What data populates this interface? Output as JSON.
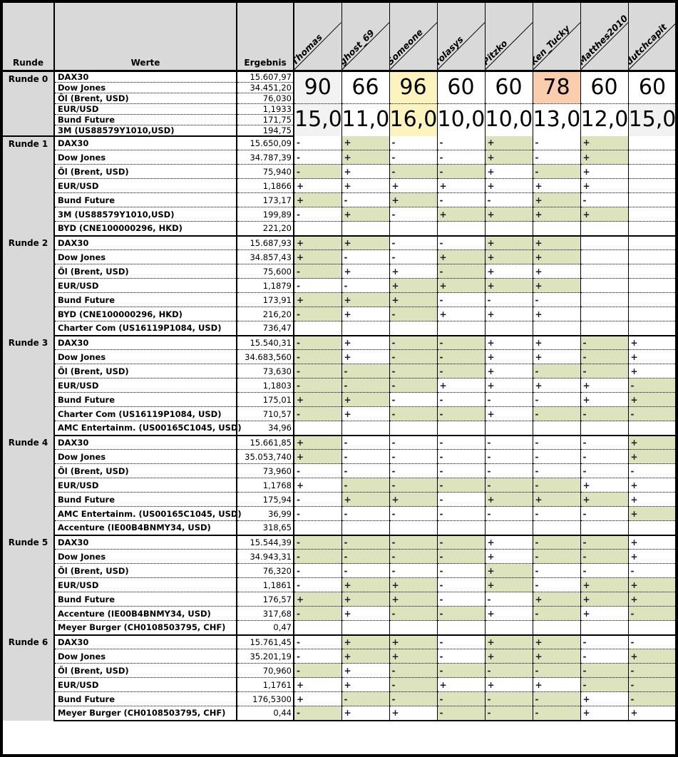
{
  "columns": {
    "runde_label": "Runde",
    "werte_label": "Werte",
    "ergebnis_label": "Ergebnis",
    "players": [
      "Thomas",
      "ghost_69",
      "Someone",
      "rolasys",
      "Pitzko",
      "Ken_Tucky",
      "Matthes2010",
      "dutchcapit"
    ]
  },
  "colors": {
    "header_gray": "#d9d9d9",
    "highlight_green": "#dde3bd",
    "leader_yellow": "#fdf3bf",
    "peach": "#f9cdae",
    "light_gray": "#f2f2f2"
  },
  "rounds": [
    {
      "label": "Runde 0",
      "scores": [
        "90",
        "66",
        "96",
        "60",
        "60",
        "78",
        "60",
        "60"
      ],
      "score_bg": [
        "gray",
        "white",
        "yellow",
        "white",
        "white",
        "peach",
        "white",
        "white"
      ],
      "averages": [
        "15,0",
        "11,0",
        "16,0",
        "10,0",
        "10,0",
        "13,0",
        "12,0",
        "15,0"
      ],
      "avg_bg": [
        "gray",
        "white",
        "yellow",
        "white",
        "white",
        "white",
        "white",
        "gray"
      ],
      "rows": [
        {
          "name": "DAX30",
          "value": "15.607,97"
        },
        {
          "name": "Dow Jones",
          "value": "34.451,20"
        },
        {
          "name": "Öl (Brent, USD)",
          "value": "76,030"
        },
        {
          "name": "EUR/USD",
          "value": "1,1933"
        },
        {
          "name": "Bund Future",
          "value": "171,75"
        },
        {
          "name": "3M (US88579Y1010,USD)",
          "value": "194,75"
        }
      ]
    },
    {
      "label": "Runde 1",
      "rows": [
        {
          "name": "DAX30",
          "value": "15.650,09",
          "picks": [
            "-",
            "+",
            "-",
            "-",
            "+",
            "-",
            "+",
            ""
          ],
          "hl": [
            0,
            1,
            0,
            0,
            1,
            0,
            1,
            0
          ]
        },
        {
          "name": "Dow Jones",
          "value": "34.787,39",
          "picks": [
            "-",
            "+",
            "-",
            "-",
            "+",
            "-",
            "+",
            ""
          ],
          "hl": [
            0,
            1,
            0,
            0,
            1,
            0,
            1,
            0
          ]
        },
        {
          "name": "Öl (Brent, USD)",
          "value": "75,940",
          "picks": [
            "-",
            "+",
            "-",
            "-",
            "+",
            "-",
            "+",
            ""
          ],
          "hl": [
            1,
            0,
            1,
            1,
            0,
            1,
            0,
            0
          ]
        },
        {
          "name": "EUR/USD",
          "value": "1,1866",
          "picks": [
            "+",
            "+",
            "+",
            "+",
            "+",
            "+",
            "+",
            ""
          ],
          "hl": [
            0,
            0,
            0,
            0,
            0,
            0,
            0,
            0
          ]
        },
        {
          "name": "Bund Future",
          "value": "173,17",
          "picks": [
            "+",
            "-",
            "+",
            "-",
            "-",
            "+",
            "-",
            ""
          ],
          "hl": [
            1,
            0,
            1,
            0,
            0,
            1,
            0,
            0
          ]
        },
        {
          "name": "3M (US88579Y1010,USD)",
          "value": "199,89",
          "picks": [
            "-",
            "+",
            "-",
            "+",
            "+",
            "+",
            "+",
            ""
          ],
          "hl": [
            0,
            1,
            0,
            1,
            1,
            1,
            1,
            0
          ]
        },
        {
          "name": "BYD (CNE100000296, HKD)",
          "value": "221,20",
          "picks": [
            "",
            "",
            "",
            "",
            "",
            "",
            "",
            ""
          ],
          "hl": [
            0,
            0,
            0,
            0,
            0,
            0,
            0,
            0
          ]
        }
      ]
    },
    {
      "label": "Runde 2",
      "rows": [
        {
          "name": "DAX30",
          "value": "15.687,93",
          "picks": [
            "+",
            "+",
            "-",
            "-",
            "+",
            "+",
            "",
            ""
          ],
          "hl": [
            1,
            1,
            0,
            0,
            1,
            1,
            0,
            0
          ]
        },
        {
          "name": "Dow Jones",
          "value": "34.857,43",
          "picks": [
            "+",
            "-",
            "-",
            "+",
            "+",
            "+",
            "",
            ""
          ],
          "hl": [
            1,
            0,
            0,
            1,
            1,
            1,
            0,
            0
          ]
        },
        {
          "name": "Öl (Brent, USD)",
          "value": "75,600",
          "picks": [
            "-",
            "+",
            "+",
            "-",
            "+",
            "+",
            "",
            ""
          ],
          "hl": [
            1,
            0,
            0,
            1,
            0,
            0,
            0,
            0
          ]
        },
        {
          "name": "EUR/USD",
          "value": "1,1879",
          "picks": [
            "-",
            "-",
            "+",
            "+",
            "+",
            "+",
            "",
            ""
          ],
          "hl": [
            0,
            0,
            1,
            1,
            1,
            1,
            0,
            0
          ]
        },
        {
          "name": "Bund Future",
          "value": "173,91",
          "picks": [
            "+",
            "+",
            "+",
            "-",
            "-",
            "-",
            "",
            ""
          ],
          "hl": [
            1,
            1,
            1,
            0,
            0,
            0,
            0,
            0
          ]
        },
        {
          "name": "BYD (CNE100000296, HKD)",
          "value": "216,20",
          "picks": [
            "-",
            "+",
            "-",
            "+",
            "+",
            "+",
            "",
            ""
          ],
          "hl": [
            1,
            0,
            1,
            0,
            0,
            0,
            0,
            0
          ]
        },
        {
          "name": "Charter Com (US16119P1084, USD)",
          "value": "736,47",
          "picks": [
            "",
            "",
            "",
            "",
            "",
            "",
            "",
            ""
          ],
          "hl": [
            0,
            0,
            0,
            0,
            0,
            0,
            0,
            0
          ]
        }
      ]
    },
    {
      "label": "Runde 3",
      "rows": [
        {
          "name": "DAX30",
          "value": "15.540,31",
          "picks": [
            "-",
            "+",
            "-",
            "-",
            "+",
            "+",
            "-",
            "+"
          ],
          "hl": [
            1,
            0,
            1,
            1,
            0,
            0,
            1,
            0
          ]
        },
        {
          "name": "Dow Jones",
          "value": "34.683,560",
          "picks": [
            "-",
            "+",
            "-",
            "-",
            "+",
            "+",
            "-",
            "+"
          ],
          "hl": [
            1,
            0,
            1,
            1,
            0,
            0,
            1,
            0
          ]
        },
        {
          "name": "Öl (Brent, USD)",
          "value": "73,630",
          "picks": [
            "-",
            "-",
            "-",
            "-",
            "+",
            "-",
            "-",
            "+"
          ],
          "hl": [
            1,
            1,
            1,
            1,
            0,
            1,
            1,
            0
          ]
        },
        {
          "name": "EUR/USD",
          "value": "1,1803",
          "picks": [
            "-",
            "-",
            "-",
            "+",
            "+",
            "+",
            "+",
            "-"
          ],
          "hl": [
            1,
            1,
            1,
            0,
            0,
            0,
            0,
            1
          ]
        },
        {
          "name": "Bund Future",
          "value": "175,01",
          "picks": [
            "+",
            "+",
            "-",
            "-",
            "-",
            "-",
            "+",
            "+"
          ],
          "hl": [
            1,
            1,
            0,
            0,
            0,
            0,
            0,
            1
          ]
        },
        {
          "name": "Charter Com (US16119P1084, USD)",
          "value": "710,57",
          "picks": [
            "-",
            "+",
            "-",
            "-",
            "+",
            "-",
            "-",
            "-"
          ],
          "hl": [
            1,
            0,
            1,
            1,
            0,
            1,
            1,
            1
          ]
        },
        {
          "name": "AMC Entertainm. (US00165C1045, USD)",
          "value": "34,96",
          "picks": [
            "",
            "",
            "",
            "",
            "",
            "",
            "",
            ""
          ],
          "hl": [
            0,
            0,
            0,
            0,
            0,
            0,
            0,
            0
          ]
        }
      ]
    },
    {
      "label": "Runde 4",
      "rows": [
        {
          "name": "DAX30",
          "value": "15.661,85",
          "picks": [
            "+",
            "-",
            "-",
            "-",
            "-",
            "-",
            "-",
            "+"
          ],
          "hl": [
            1,
            0,
            0,
            0,
            0,
            0,
            0,
            1
          ]
        },
        {
          "name": "Dow Jones",
          "value": "35.053,740",
          "picks": [
            "+",
            "-",
            "-",
            "-",
            "-",
            "-",
            "-",
            "+"
          ],
          "hl": [
            1,
            0,
            0,
            0,
            0,
            0,
            0,
            1
          ]
        },
        {
          "name": "Öl (Brent, USD)",
          "value": "73,960",
          "picks": [
            "-",
            "-",
            "-",
            "-",
            "-",
            "-",
            "-",
            "-"
          ],
          "hl": [
            0,
            0,
            0,
            0,
            0,
            0,
            0,
            0
          ]
        },
        {
          "name": "EUR/USD",
          "value": "1,1768",
          "picks": [
            "+",
            "-",
            "-",
            "-",
            "-",
            "-",
            "+",
            "+"
          ],
          "hl": [
            0,
            1,
            1,
            1,
            1,
            1,
            0,
            0
          ]
        },
        {
          "name": "Bund Future",
          "value": "175,94",
          "picks": [
            "-",
            "+",
            "+",
            "-",
            "+",
            "+",
            "+",
            "+"
          ],
          "hl": [
            0,
            1,
            1,
            0,
            1,
            1,
            1,
            0
          ]
        },
        {
          "name": "AMC Entertainm. (US00165C1045, USD)",
          "value": "36,99",
          "picks": [
            "-",
            "-",
            "-",
            "-",
            "-",
            "-",
            "-",
            "+"
          ],
          "hl": [
            0,
            0,
            0,
            0,
            0,
            0,
            0,
            1
          ]
        },
        {
          "name": "Accenture (IE00B4BNMY34, USD)",
          "value": "318,65",
          "picks": [
            "",
            "",
            "",
            "",
            "",
            "",
            "",
            ""
          ],
          "hl": [
            0,
            0,
            0,
            0,
            0,
            0,
            0,
            0
          ]
        }
      ]
    },
    {
      "label": "Runde 5",
      "rows": [
        {
          "name": "DAX30",
          "value": "15.544,39",
          "picks": [
            "-",
            "-",
            "-",
            "-",
            "+",
            "-",
            "-",
            "+"
          ],
          "hl": [
            1,
            1,
            1,
            1,
            0,
            1,
            1,
            0
          ]
        },
        {
          "name": "Dow Jones",
          "value": "34.943,31",
          "picks": [
            "-",
            "-",
            "-",
            "-",
            "+",
            "-",
            "-",
            "+"
          ],
          "hl": [
            1,
            1,
            1,
            1,
            0,
            1,
            1,
            0
          ]
        },
        {
          "name": "Öl (Brent, USD)",
          "value": "76,320",
          "picks": [
            "-",
            "-",
            "-",
            "-",
            "+",
            "-",
            "-",
            "-"
          ],
          "hl": [
            0,
            0,
            0,
            0,
            1,
            0,
            0,
            0
          ]
        },
        {
          "name": "EUR/USD",
          "value": "1,1861",
          "picks": [
            "-",
            "+",
            "+",
            "-",
            "+",
            "-",
            "+",
            "+"
          ],
          "hl": [
            0,
            1,
            1,
            0,
            1,
            0,
            1,
            1
          ]
        },
        {
          "name": "Bund Future",
          "value": "176,57",
          "picks": [
            "+",
            "+",
            "+",
            "-",
            "-",
            "+",
            "+",
            "+"
          ],
          "hl": [
            1,
            1,
            1,
            0,
            0,
            1,
            1,
            1
          ]
        },
        {
          "name": "Accenture (IE00B4BNMY34, USD)",
          "value": "317,68",
          "picks": [
            "-",
            "+",
            "-",
            "-",
            "+",
            "-",
            "+",
            "-"
          ],
          "hl": [
            1,
            0,
            1,
            1,
            0,
            1,
            0,
            1
          ]
        },
        {
          "name": "Meyer Burger (CH0108503795, CHF)",
          "value": "0,47",
          "picks": [
            "",
            "",
            "",
            "",
            "",
            "",
            "",
            ""
          ],
          "hl": [
            0,
            0,
            0,
            0,
            0,
            0,
            0,
            0
          ]
        }
      ]
    },
    {
      "label": "Runde 6",
      "rows": [
        {
          "name": "DAX30",
          "value": "15.761,45",
          "picks": [
            "-",
            "+",
            "+",
            "-",
            "+",
            "+",
            "-",
            "-"
          ],
          "hl": [
            0,
            1,
            1,
            0,
            1,
            1,
            0,
            0
          ]
        },
        {
          "name": "Dow Jones",
          "value": "35.201,19",
          "picks": [
            "-",
            "+",
            "+",
            "-",
            "+",
            "+",
            "-",
            "+"
          ],
          "hl": [
            0,
            1,
            1,
            0,
            1,
            1,
            0,
            1
          ]
        },
        {
          "name": "Öl (Brent, USD)",
          "value": "70,960",
          "picks": [
            "-",
            "+",
            "-",
            "-",
            "-",
            "-",
            "-",
            "-"
          ],
          "hl": [
            1,
            0,
            1,
            1,
            1,
            1,
            1,
            1
          ]
        },
        {
          "name": "EUR/USD",
          "value": "1,1761",
          "picks": [
            "+",
            "+",
            "-",
            "+",
            "+",
            "+",
            "-",
            "-"
          ],
          "hl": [
            0,
            0,
            1,
            0,
            0,
            0,
            1,
            1
          ]
        },
        {
          "name": "Bund Future",
          "value": "176,5300",
          "picks": [
            "+",
            "-",
            "-",
            "-",
            "-",
            "-",
            "+",
            "-"
          ],
          "hl": [
            0,
            1,
            1,
            1,
            1,
            1,
            0,
            1
          ]
        },
        {
          "name": "Meyer Burger (CH0108503795, CHF)",
          "value": "0,44",
          "picks": [
            "-",
            "+",
            "+",
            "-",
            "-",
            "-",
            "+",
            "+"
          ],
          "hl": [
            1,
            0,
            0,
            1,
            1,
            1,
            0,
            0
          ]
        }
      ]
    }
  ]
}
